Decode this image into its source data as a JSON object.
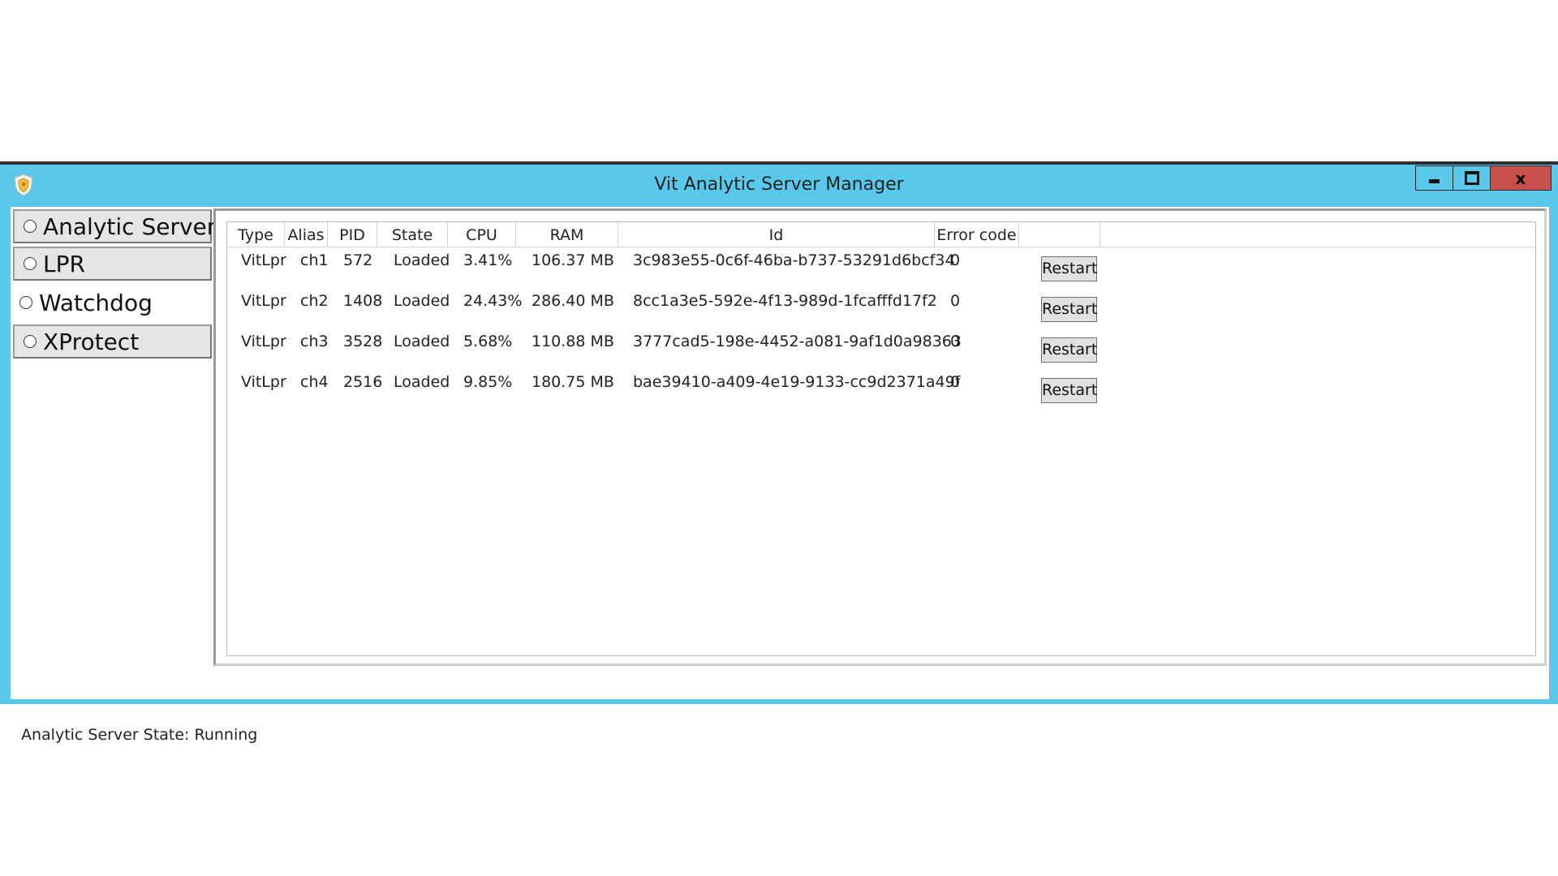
{
  "window": {
    "title": "Vit Analytic Server Manager",
    "close_glyph": "x",
    "accent_color": "#5ac8ea",
    "close_color": "#c7504a",
    "icons": [
      "shield-icon",
      "minimize-icon",
      "maximize-icon",
      "close-icon"
    ]
  },
  "sidebar": {
    "items": [
      {
        "label": "Analytic Server",
        "selected": false
      },
      {
        "label": "LPR",
        "selected": false
      },
      {
        "label": "Watchdog",
        "selected": false
      },
      {
        "label": "XProtect",
        "selected": false
      }
    ]
  },
  "table": {
    "columns": [
      "Type",
      "Alias",
      "PID",
      "State",
      "CPU",
      "RAM",
      "Id",
      "Error code",
      ""
    ],
    "rows": [
      {
        "type": "VitLpr",
        "alias": "ch1",
        "pid": "572",
        "state": "Loaded",
        "cpu": "3.41%",
        "ram": "106.37 MB",
        "id": "3c983e55-0c6f-46ba-b737-53291d6bcf34",
        "error_code": "0",
        "action": "Restart"
      },
      {
        "type": "VitLpr",
        "alias": "ch2",
        "pid": "1408",
        "state": "Loaded",
        "cpu": "24.43%",
        "ram": "286.40 MB",
        "id": "8cc1a3e5-592e-4f13-989d-1fcafffd17f2",
        "error_code": "0",
        "action": "Restart"
      },
      {
        "type": "VitLpr",
        "alias": "ch3",
        "pid": "3528",
        "state": "Loaded",
        "cpu": "5.68%",
        "ram": "110.88 MB",
        "id": "3777cad5-198e-4452-a081-9af1d0a98363",
        "error_code": "0",
        "action": "Restart"
      },
      {
        "type": "VitLpr",
        "alias": "ch4",
        "pid": "2516",
        "state": "Loaded",
        "cpu": "9.85%",
        "ram": "180.75 MB",
        "id": "bae39410-a409-4e19-9133-cc9d2371a49f",
        "error_code": "0",
        "action": "Restart"
      }
    ]
  },
  "status": {
    "text": "Analytic Server State: Running"
  }
}
